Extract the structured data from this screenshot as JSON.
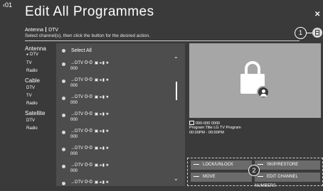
{
  "header": {
    "back_label": "‹01",
    "title": "Edit All Programmes",
    "close_label": "✕",
    "breadcrumb": [
      "Antenna",
      "DTV"
    ],
    "instruction": "Select channel(s), then click the button for the desired action.",
    "callout_1": "1",
    "filter_icon": "channel-list-icon"
  },
  "sidebar": {
    "groups": [
      {
        "label": "Antenna",
        "items": [
          "DTV",
          "TV",
          "Radio"
        ],
        "selected": "DTV"
      },
      {
        "label": "Cable",
        "items": [
          "DTV",
          "TV",
          "Radio"
        ]
      },
      {
        "label": "Satellite",
        "items": [
          "DTV",
          "Radio"
        ]
      }
    ]
  },
  "list": {
    "select_all": "Select All",
    "channels": [
      {
        "type": "→DTV",
        "number": "0-0",
        "icons": "▣ ◂ ▮ ★",
        "name": "000"
      },
      {
        "type": "→DTV",
        "number": "0-0",
        "icons": "▣ ◂ ▮ ★",
        "name": "000"
      },
      {
        "type": "→DTV",
        "number": "0-0",
        "icons": "▣ ◂ ▮ ★",
        "name": "000"
      },
      {
        "type": "→DTV",
        "number": "0-0",
        "icons": "▣ ◂ ▮ ★",
        "name": "000"
      },
      {
        "type": "→DTV",
        "number": "0-0",
        "icons": "▣ ◂ ▮ ★",
        "name": "000"
      },
      {
        "type": "→DTV",
        "number": "0-0",
        "icons": "▣ ◂ ▮ ★",
        "name": "000"
      },
      {
        "type": "→DTV",
        "number": "0-0",
        "icons": "▣ ◂ ▮ ★",
        "name": "000"
      },
      {
        "type": "→DTV",
        "number": "0-0",
        "icons": "▣ ◂ ▮ ★",
        "name": "000"
      }
    ],
    "scroll_up": "⌃",
    "scroll_down": "⌄"
  },
  "preview": {
    "icon": "lock-user-icon",
    "line1": "000-000 0000",
    "line2": "Program Title LG TV Program",
    "line3": "00:00PM - 00:00PM"
  },
  "actions": {
    "lock_unlock": "LOCK/UNLOCK",
    "skip_restore": "SKIP/RESTORE",
    "move": "MOVE",
    "edit_channel_numbers": "EDIT CHANNEL NUMBERS",
    "callout_2": "2"
  },
  "colors": {
    "background": "#3a3a3a",
    "list_panel": "#4d4d4d",
    "preview_panel": "#a6a6a6",
    "button": "#6b6b6b"
  }
}
